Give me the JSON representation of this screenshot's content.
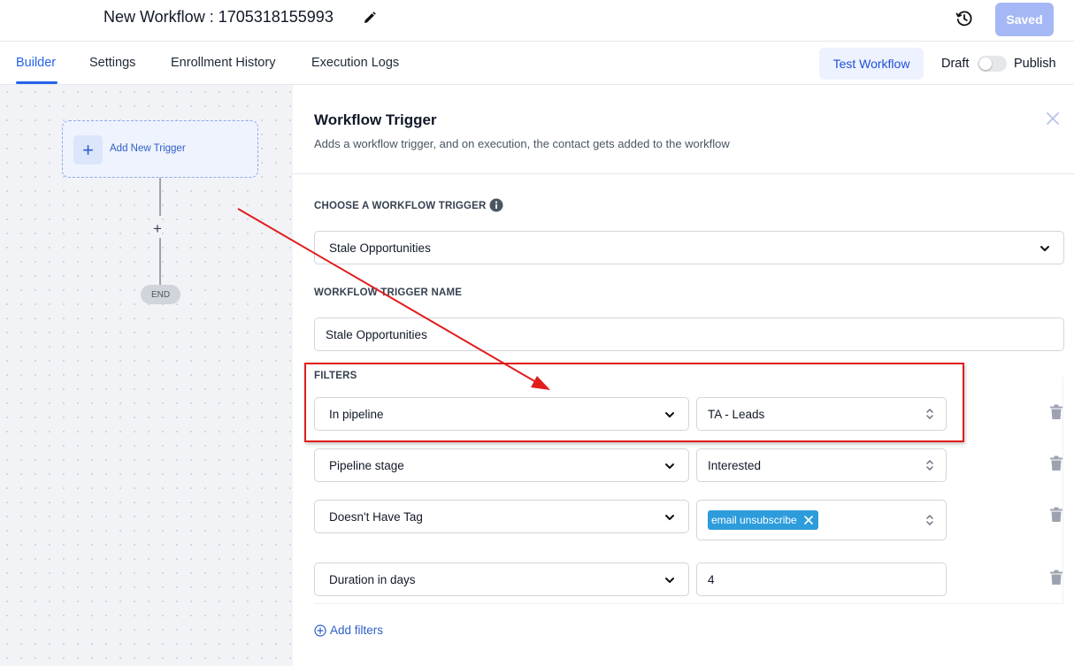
{
  "header": {
    "workflow_title": "New Workflow : 1705318155993",
    "saved_label": "Saved"
  },
  "tabs": [
    {
      "label": "Builder",
      "active": true
    },
    {
      "label": "Settings",
      "active": false
    },
    {
      "label": "Enrollment History",
      "active": false
    },
    {
      "label": "Execution Logs",
      "active": false
    }
  ],
  "toolbar": {
    "test_workflow_label": "Test Workflow",
    "draft_label": "Draft",
    "publish_label": "Publish",
    "published": false
  },
  "canvas": {
    "add_trigger_label": "Add New Trigger",
    "end_label": "END"
  },
  "panel": {
    "title": "Workflow Trigger",
    "subtitle": "Adds a workflow trigger, and on execution, the contact gets added to the workflow",
    "choose_trigger_label": "CHOOSE A WORKFLOW TRIGGER",
    "trigger_value": "Stale Opportunities",
    "trigger_name_label": "WORKFLOW TRIGGER NAME",
    "trigger_name_value": "Stale Opportunities",
    "filters_label": "FILTERS",
    "filters": [
      {
        "field": "In pipeline",
        "value": "TA - Leads"
      },
      {
        "field": "Pipeline stage",
        "value": "Interested"
      },
      {
        "field": "Doesn't Have Tag",
        "tag": "email unsubscribe"
      },
      {
        "field": "Duration in days",
        "value": "4"
      }
    ],
    "add_filters_label": "Add filters"
  },
  "colors": {
    "accent": "#2563eb",
    "saved_button": "#a5b8f5",
    "tag_chip": "#2d9cdb",
    "annotation_red": "#e11d1d"
  },
  "icons": [
    "edit-icon",
    "history-icon",
    "info-icon",
    "chevron-down-icon",
    "updown-icon",
    "close-icon",
    "trash-icon",
    "plus-icon",
    "add-circle-icon"
  ]
}
